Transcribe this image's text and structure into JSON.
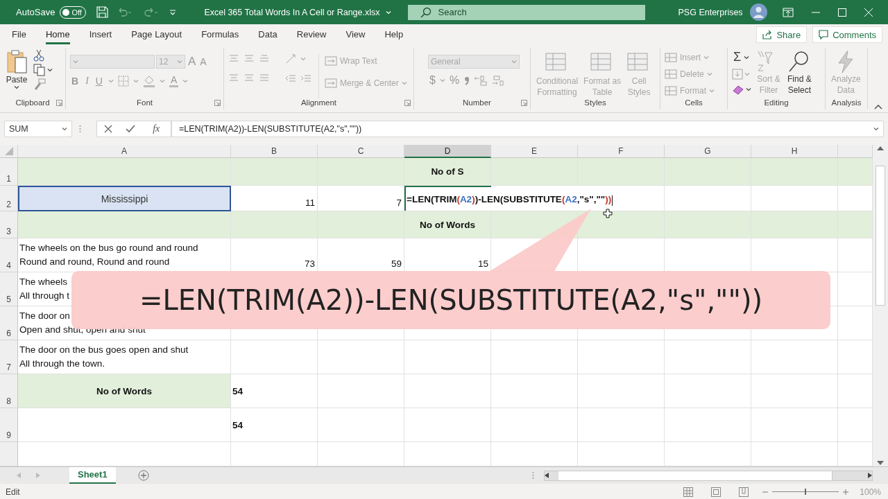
{
  "title_bar": {
    "autosave_label": "AutoSave",
    "autosave": {
      "on": false,
      "label": "Off"
    },
    "filename": "Excel 365 Total Words In A Cell or Range.xlsx",
    "search": {
      "placeholder": "Search"
    },
    "user": "PSG Enterprises"
  },
  "menu_tabs": [
    {
      "label": "File",
      "selected": false
    },
    {
      "label": "Home",
      "selected": true
    },
    {
      "label": "Insert",
      "selected": false
    },
    {
      "label": "Page Layout",
      "selected": false
    },
    {
      "label": "Formulas",
      "selected": false
    },
    {
      "label": "Data",
      "selected": false
    },
    {
      "label": "Review",
      "selected": false
    },
    {
      "label": "View",
      "selected": false
    },
    {
      "label": "Help",
      "selected": false
    }
  ],
  "share": "Share",
  "comments": "Comments",
  "ribbon": {
    "clipboard": {
      "group": "Clipboard",
      "paste": "Paste"
    },
    "font": {
      "group": "Font",
      "size": "12",
      "grow": "A",
      "shrink": "A",
      "bold": "B",
      "italic": "I",
      "underline": "U",
      "font_color": "A"
    },
    "alignment": {
      "group": "Alignment",
      "buttons": [
        {
          "label": "Wrap Text",
          "disabled": true
        },
        {
          "label": "Merge & Center",
          "disabled": true
        }
      ]
    },
    "number": {
      "group": "Number",
      "format": "General",
      "currency": "$",
      "percent": "%"
    },
    "styles": {
      "group": "Styles",
      "buttons": [
        {
          "lines": [
            "Conditional",
            "Formatting"
          ],
          "disabled": true
        },
        {
          "lines": [
            "Format as",
            "Table"
          ],
          "disabled": true
        },
        {
          "lines": [
            "Cell",
            "Styles"
          ],
          "disabled": true
        }
      ]
    },
    "cells": {
      "group": "Cells",
      "buttons": [
        {
          "label": "Insert",
          "disabled": true
        },
        {
          "label": "Delete",
          "disabled": true
        },
        {
          "label": "Format",
          "disabled": true
        }
      ]
    },
    "editing": {
      "group": "Editing",
      "autosum": "Σ",
      "buttons": [
        {
          "lines": [
            "Sort &",
            "Filter"
          ],
          "disabled": true
        },
        {
          "lines": [
            "Find &",
            "Select"
          ],
          "disabled": false
        }
      ]
    },
    "analysis": {
      "group": "Analysis",
      "buttons": [
        {
          "lines": [
            "Analyze",
            "Data"
          ],
          "disabled": true
        }
      ]
    }
  },
  "formula_bar": {
    "name_box": "SUM",
    "function_label": "fx",
    "formula": "=LEN(TRIM(A2))-LEN(SUBSTITUTE(A2,\"s\",\"\"))"
  },
  "columns": [
    {
      "label": "A",
      "selected": false
    },
    {
      "label": "B",
      "selected": false
    },
    {
      "label": "C",
      "selected": false
    },
    {
      "label": "D",
      "selected": true
    },
    {
      "label": "E",
      "selected": false
    },
    {
      "label": "F",
      "selected": false
    },
    {
      "label": "G",
      "selected": false
    },
    {
      "label": "H",
      "selected": false
    }
  ],
  "rows": [
    {
      "number": "1",
      "shaded": true,
      "cells": {
        "D": {
          "kind": "heading",
          "text": "No of S"
        }
      }
    },
    {
      "number": "2",
      "shaded": false,
      "cells": {
        "A": {
          "kind": "input",
          "text": "Mississippi",
          "highlighted": true
        },
        "B": {
          "kind": "number",
          "text": "11"
        },
        "C": {
          "kind": "number",
          "text": "7"
        },
        "D": {
          "kind": "edit",
          "segments": [
            {
              "kind": "plain",
              "text": "=LEN(TRIM"
            },
            {
              "kind": "paren",
              "text": "("
            },
            {
              "kind": "ref",
              "text": "A2"
            },
            {
              "kind": "paren",
              "text": ")"
            },
            {
              "kind": "plain",
              "text": ")-LEN(SUBSTITUTE"
            },
            {
              "kind": "paren",
              "text": "("
            },
            {
              "kind": "ref",
              "text": "A2"
            },
            {
              "kind": "plain",
              "text": ",\"s\",\"\""
            },
            {
              "kind": "paren",
              "text": "))"
            }
          ]
        }
      }
    },
    {
      "number": "3",
      "shaded": true,
      "cells": {
        "D": {
          "kind": "heading",
          "text": "No of Words"
        }
      }
    },
    {
      "number": "4",
      "shaded": false,
      "cells": {
        "A": {
          "kind": "text",
          "lines": [
            "The wheels on the bus go round and round",
            "Round and round, Round and round"
          ]
        },
        "B": {
          "kind": "number",
          "text": "73"
        },
        "C": {
          "kind": "number",
          "text": "59"
        },
        "D": {
          "kind": "number",
          "text": "15"
        }
      }
    },
    {
      "number": "5",
      "shaded": false,
      "cells": {
        "A": {
          "kind": "text",
          "lines": [
            "The wheels",
            "All through t"
          ]
        }
      }
    },
    {
      "number": "6",
      "shaded": false,
      "cells": {
        "A": {
          "kind": "text",
          "lines": [
            "The door on",
            "Open and shut, open and shut"
          ]
        }
      }
    },
    {
      "number": "7",
      "shaded": false,
      "cells": {
        "A": {
          "kind": "text",
          "lines": [
            "The door on the bus goes open and shut",
            "All through the town."
          ]
        }
      }
    },
    {
      "number": "8",
      "shaded": false,
      "cells": {
        "A": {
          "kind": "heading",
          "text": "No of Words",
          "shaded": true
        },
        "B": {
          "kind": "total",
          "text": "54"
        }
      }
    },
    {
      "number": "9",
      "shaded": false,
      "cells": {
        "B": {
          "kind": "total",
          "text": "54"
        }
      }
    }
  ],
  "callout": {
    "text": "=LEN(TRIM(A2))-LEN(SUBSTITUTE(A2,\"s\",\"\"))"
  },
  "sheet_tabs": [
    {
      "label": "Sheet1",
      "selected": true
    }
  ],
  "status_bar": {
    "mode": "Edit",
    "zoom": {
      "level": 0.5,
      "reading": "100%"
    }
  }
}
